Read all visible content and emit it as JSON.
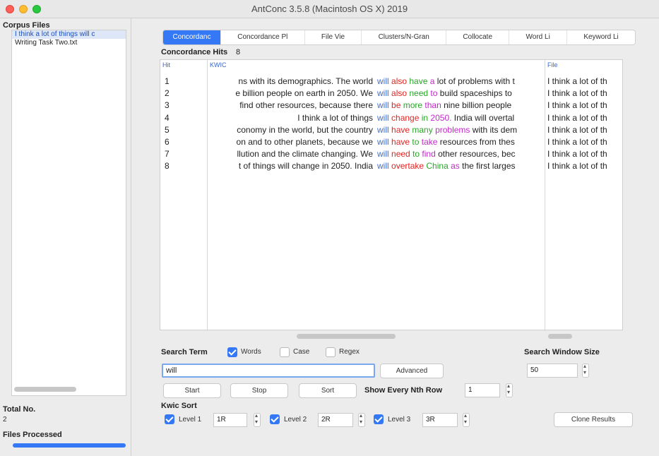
{
  "window": {
    "title": "AntConc 3.5.8 (Macintosh OS X) 2019"
  },
  "left": {
    "corpus_files_label": "Corpus Files",
    "files": [
      "I think a lot of things will c",
      "Writing Task Two.txt"
    ],
    "total_no_label": "Total No.",
    "total_no_value": "2",
    "files_processed_label": "Files Processed",
    "progress_percent": 100
  },
  "tabs": [
    "Concordanc",
    "Concordance Pl",
    "File Vie",
    "Clusters/N-Gran",
    "Collocate",
    "Word Li",
    "Keyword Li"
  ],
  "concordance": {
    "hits_label": "Concordance Hits",
    "hits_count": "8",
    "headers": {
      "hit": "Hit",
      "kwic": "KWIC",
      "file": "File"
    },
    "rows": [
      {
        "hit": "1",
        "left": "ns with its demographics. The world",
        "keyword": "will",
        "w1": "also",
        "w2": "have",
        "w3": "a",
        "rest": "lot of problems with t",
        "file": "I think a lot of th"
      },
      {
        "hit": "2",
        "left": "e billion people on earth in 2050. We",
        "keyword": "will",
        "w1": "also",
        "w2": "need",
        "w3": "to",
        "rest": "build spaceships to",
        "file": "I think a lot of th"
      },
      {
        "hit": "3",
        "left": "find other resources, because there",
        "keyword": "will",
        "w1": "be",
        "w2": "more",
        "w3": "than",
        "rest": "nine billion people",
        "file": "I think a lot of th"
      },
      {
        "hit": "4",
        "left": "I think a lot of things",
        "keyword": "will",
        "w1": "change",
        "w2": "in",
        "w3": "2050.",
        "rest": "India will overtal",
        "file": "I think a lot of th"
      },
      {
        "hit": "5",
        "left": "conomy in the world, but the country",
        "keyword": "will",
        "w1": "have",
        "w2": "many",
        "w3": "problems",
        "rest": "with its dem",
        "file": "I think a lot of th"
      },
      {
        "hit": "6",
        "left": "on and to other planets, because we",
        "keyword": "will",
        "w1": "have",
        "w2": "to",
        "w3": "take",
        "rest": "resources from thes",
        "file": "I think a lot of th"
      },
      {
        "hit": "7",
        "left": "llution and the climate changing. We",
        "keyword": "will",
        "w1": "need",
        "w2": "to",
        "w3": "find",
        "rest": "other resources, bec",
        "file": "I think a lot of th"
      },
      {
        "hit": "8",
        "left": "t of things will change in 2050. India",
        "keyword": "will",
        "w1": "overtake",
        "w2": "China",
        "w3": "as",
        "rest": "the first larges",
        "file": "I think a lot of th"
      }
    ]
  },
  "search": {
    "term_label": "Search Term",
    "words_label": "Words",
    "case_label": "Case",
    "regex_label": "Regex",
    "words_checked": true,
    "case_checked": false,
    "regex_checked": false,
    "term_value": "will",
    "advanced_label": "Advanced",
    "window_size_label": "Search Window Size",
    "window_size_value": "50",
    "start_label": "Start",
    "stop_label": "Stop",
    "sort_label": "Sort",
    "nth_row_label": "Show Every Nth Row",
    "nth_row_value": "1"
  },
  "kwic_sort": {
    "label": "Kwic Sort",
    "level1_label": "Level 1",
    "level1_value": "1R",
    "level2_label": "Level 2",
    "level2_value": "2R",
    "level3_label": "Level 3",
    "level3_value": "3R",
    "clone_label": "Clone Results"
  },
  "colors": {
    "keyword": "#3a6cd8",
    "w1": "#e02424",
    "w2": "#2aa52a",
    "w3": "#c229c9",
    "accent": "#3478f6"
  }
}
